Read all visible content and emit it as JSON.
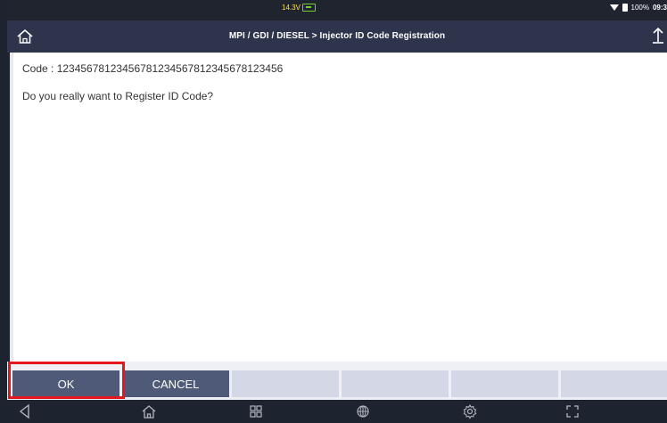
{
  "status_bar": {
    "voltage": "14.3V",
    "battery_percent": "100%",
    "time": "09:3"
  },
  "header": {
    "title": "MPI / GDI / DIESEL  >  Injector ID Code Registration"
  },
  "content": {
    "code_line": "Code : 12345678123456781234567812345678123456",
    "question": "Do you really want to Register ID Code?"
  },
  "buttons": {
    "ok_label": "OK",
    "cancel_label": "CANCEL"
  },
  "nav": {
    "icons": [
      "back-icon",
      "home-icon",
      "recent-apps-icon",
      "browser-icon",
      "settings-icon",
      "screenshot-icon"
    ]
  },
  "colors": {
    "title_bar": "#2d344c",
    "active_button": "#4f5a79",
    "inactive_button": "#d4d8e6",
    "highlight": "#e3171c",
    "voltage_text": "#ffe14a",
    "battery_green": "#6ed12d"
  }
}
